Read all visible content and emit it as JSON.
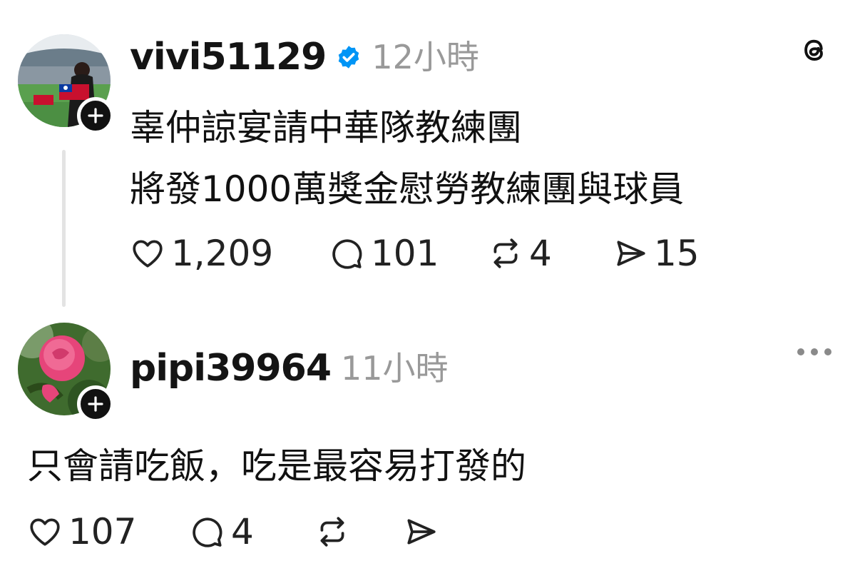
{
  "post": {
    "username": "vivi51129",
    "verified": true,
    "timestamp": "12小時",
    "text_line1": "辜仲諒宴請中華隊教練團",
    "text_line2": "將發1000萬獎金慰勞教練團與球員",
    "likes": "1,209",
    "comments": "101",
    "reposts": "4",
    "shares": "15",
    "avatar_icon": "baseball-stadium-photo",
    "app_icon": "threads-logo-icon"
  },
  "reply": {
    "username": "pipi39964",
    "timestamp": "11小時",
    "text": "只會請吃飯，吃是最容易打發的",
    "likes": "107",
    "comments": "4",
    "avatar_icon": "pink-rose-photo"
  },
  "colors": {
    "verified_blue": "#0095f6",
    "muted_text": "#999999",
    "badge_black": "#111111"
  }
}
